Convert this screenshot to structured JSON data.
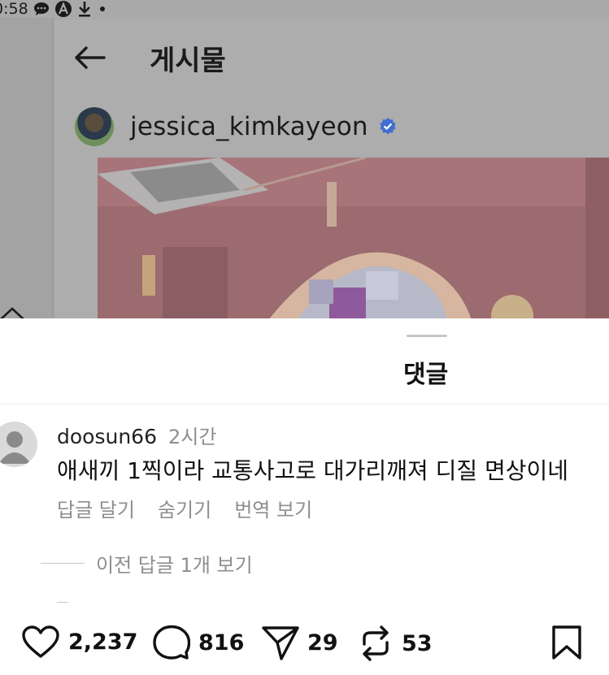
{
  "status_bar": {
    "time": "0:58"
  },
  "post_header": {
    "title": "게시물"
  },
  "author": {
    "username": "jessica_kimkayeon",
    "verified": true
  },
  "sheet": {
    "title": "댓글"
  },
  "comment": {
    "username": "doosun66",
    "time": "2시간",
    "text": "애새끼 1찍이라 교통사고로 대가리깨져 디질 면상이네",
    "actions": [
      "답글 달기",
      "숨기기",
      "번역 보기"
    ]
  },
  "view_replies": "이전 답글 1개 보기",
  "action_bar": {
    "likes": "2,237",
    "comments": "816",
    "shares": "29",
    "reposts": "53"
  },
  "colors": {
    "overlay_bg": "#a9a9a9",
    "verified_blue": "#3f6fd1",
    "muted_text": "#8e8e8e"
  }
}
